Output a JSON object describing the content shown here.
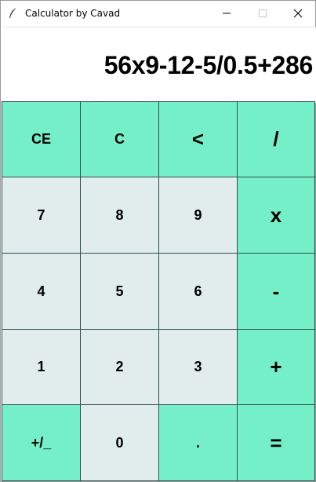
{
  "window": {
    "title": "Calculator by Cavad",
    "minimize_glyph": "—",
    "maximize_glyph": "☐",
    "close_glyph": "✕"
  },
  "display": {
    "expression": "56x9-12-5/0.5+286"
  },
  "keys": [
    {
      "label": "CE",
      "kind": "op",
      "row": 0,
      "col": 0,
      "name": "clear-entry-button"
    },
    {
      "label": "C",
      "kind": "op",
      "row": 0,
      "col": 1,
      "name": "clear-button"
    },
    {
      "label": "<",
      "kind": "op",
      "row": 0,
      "col": 2,
      "name": "backspace-button",
      "big": true
    },
    {
      "label": "/",
      "kind": "op",
      "row": 0,
      "col": 3,
      "name": "divide-button",
      "big": true
    },
    {
      "label": "7",
      "kind": "num",
      "row": 1,
      "col": 0,
      "name": "digit-7-button"
    },
    {
      "label": "8",
      "kind": "num",
      "row": 1,
      "col": 1,
      "name": "digit-8-button"
    },
    {
      "label": "9",
      "kind": "num",
      "row": 1,
      "col": 2,
      "name": "digit-9-button"
    },
    {
      "label": "x",
      "kind": "op",
      "row": 1,
      "col": 3,
      "name": "multiply-button",
      "big": true
    },
    {
      "label": "4",
      "kind": "num",
      "row": 2,
      "col": 0,
      "name": "digit-4-button"
    },
    {
      "label": "5",
      "kind": "num",
      "row": 2,
      "col": 1,
      "name": "digit-5-button"
    },
    {
      "label": "6",
      "kind": "num",
      "row": 2,
      "col": 2,
      "name": "digit-6-button"
    },
    {
      "label": "-",
      "kind": "op",
      "row": 2,
      "col": 3,
      "name": "subtract-button",
      "big": true
    },
    {
      "label": "1",
      "kind": "num",
      "row": 3,
      "col": 0,
      "name": "digit-1-button"
    },
    {
      "label": "2",
      "kind": "num",
      "row": 3,
      "col": 1,
      "name": "digit-2-button"
    },
    {
      "label": "3",
      "kind": "num",
      "row": 3,
      "col": 2,
      "name": "digit-3-button"
    },
    {
      "label": "+",
      "kind": "op",
      "row": 3,
      "col": 3,
      "name": "add-button",
      "big": true
    },
    {
      "label": "+/_",
      "kind": "op",
      "row": 4,
      "col": 0,
      "name": "toggle-sign-button"
    },
    {
      "label": "0",
      "kind": "num",
      "row": 4,
      "col": 1,
      "name": "digit-0-button"
    },
    {
      "label": ".",
      "kind": "op",
      "row": 4,
      "col": 2,
      "name": "decimal-point-button"
    },
    {
      "label": "=",
      "kind": "op",
      "row": 4,
      "col": 3,
      "name": "equals-button",
      "big": true
    }
  ]
}
